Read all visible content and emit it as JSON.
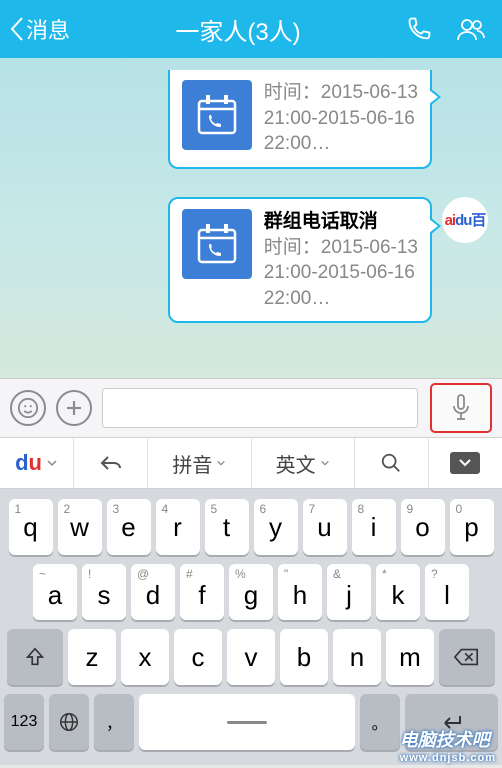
{
  "nav": {
    "back_label": "消息",
    "title": "一家人(3人)"
  },
  "avatar_text": {
    "a": "ai",
    "d": "du",
    "b": "百"
  },
  "messages": [
    {
      "title": "",
      "time1": "时间：2015-06-13",
      "time2": "21:00-2015-06-16",
      "time3": "22:00…"
    },
    {
      "title": "群组电话取消",
      "time1": "时间：2015-06-13",
      "time2": "21:00-2015-06-16",
      "time3": "22:00…"
    }
  ],
  "kb_toolbar": {
    "pinyin": "拼音",
    "english": "英文"
  },
  "keys": {
    "row1": [
      "q",
      "w",
      "e",
      "r",
      "t",
      "y",
      "u",
      "i",
      "o",
      "p"
    ],
    "nums": [
      "1",
      "2",
      "3",
      "4",
      "5",
      "6",
      "7",
      "8",
      "9",
      "0"
    ],
    "row2": [
      "a",
      "s",
      "d",
      "f",
      "g",
      "h",
      "j",
      "k",
      "l"
    ],
    "syms": [
      "~",
      "!",
      "@",
      "#",
      "%",
      "\"",
      "&",
      "*",
      "?"
    ],
    "row3": [
      "z",
      "x",
      "c",
      "v",
      "b",
      "n",
      "m"
    ],
    "arrow": "^",
    "bottom": {
      "num": "123",
      "earth": "🌐",
      "comma": "，",
      "space": "",
      "period": "。",
      "enter": "↵"
    }
  },
  "watermark": {
    "main": "电脑技术吧",
    "sub": "www.dnjsb.com"
  }
}
